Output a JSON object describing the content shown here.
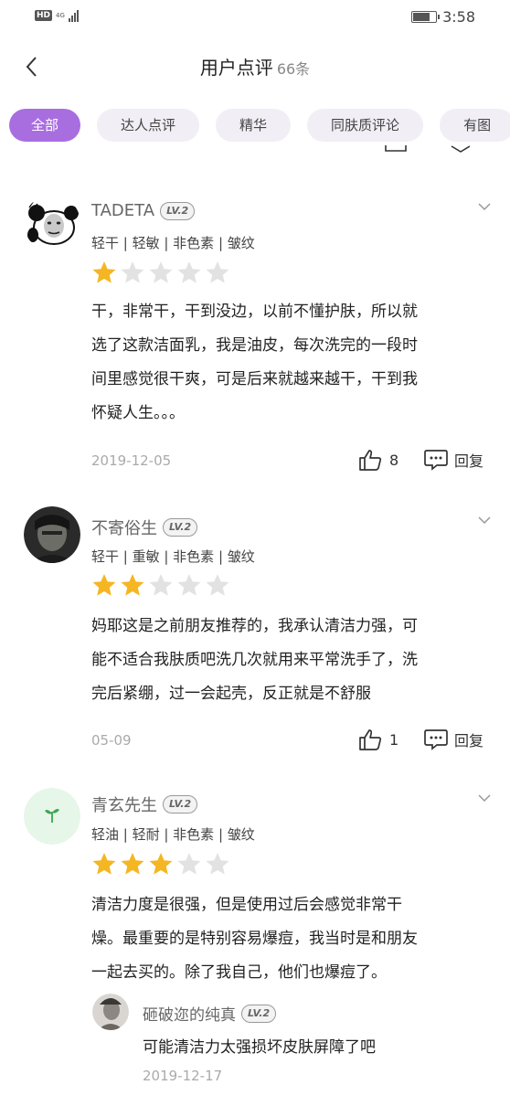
{
  "status_bar": {
    "hd": "HD",
    "network": "4G",
    "time": "3:58",
    "battery_level": 0.75
  },
  "header": {
    "title": "用户点评",
    "count": "66条"
  },
  "tabs": [
    {
      "label": "全部",
      "active": true
    },
    {
      "label": "达人点评",
      "active": false
    },
    {
      "label": "精华",
      "active": false
    },
    {
      "label": "同肤质评论",
      "active": false
    },
    {
      "label": "有图",
      "active": false
    }
  ],
  "reviews": [
    {
      "username": "TADETA",
      "level": "LV.2",
      "tags": "轻干 | 轻敏 | 非色素 | 皱纹",
      "rating": 1,
      "text_lines": [
        "干，非常干，干到没边，以前不懂护肤，所以就",
        "选了这款洁面乳，我是油皮，每次洗完的一段时",
        "间里感觉很干爽，可是后来就越来越干，干到我",
        "怀疑人生。。。"
      ],
      "date": "2019-12-05",
      "likes": "8",
      "reply_label": "回复"
    },
    {
      "username": "不寄俗生",
      "level": "LV.2",
      "tags": "轻干 | 重敏 | 非色素 | 皱纹",
      "rating": 2,
      "text_lines": [
        "妈耶这是之前朋友推荐的，我承认清洁力强，可",
        "能不适合我肤质吧洗几次就用来平常洗手了，洗",
        "完后紧绷，过一会起壳，反正就是不舒服"
      ],
      "date": "05-09",
      "likes": "1",
      "reply_label": "回复"
    },
    {
      "username": "青玄先生",
      "level": "LV.2",
      "tags": "轻油 | 轻耐 | 非色素 | 皱纹",
      "rating": 3,
      "text_lines": [
        "清洁力度是很强，但是使用过后会感觉非常干",
        "燥。最重要的是特别容易爆痘，我当时是和朋友",
        "一起去买的。除了我自己，他们也爆痘了。"
      ],
      "sub_reply": {
        "username": "砸破迩的纯真",
        "level": "LV.2",
        "text": "可能清洁力太强损坏皮肤屏障了吧",
        "date": "2019-12-17"
      }
    }
  ],
  "colors": {
    "accent": "#a86ee0",
    "tab_bg": "#f1eef6",
    "star_on": "#f5b624",
    "star_off": "#e2e2e2"
  }
}
